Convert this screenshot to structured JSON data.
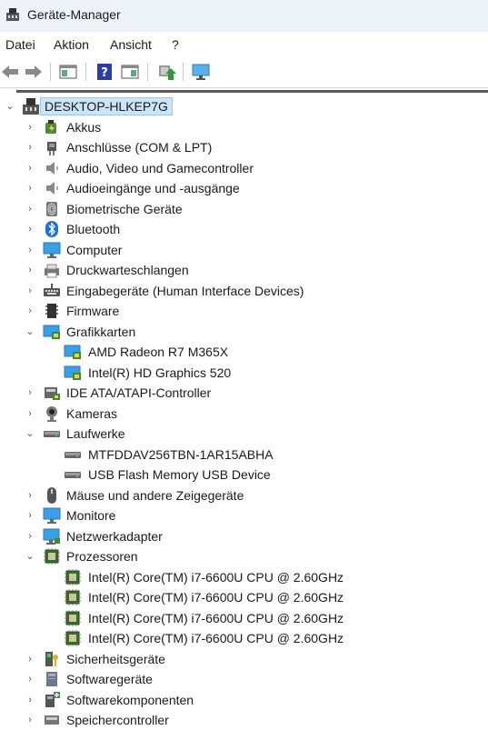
{
  "window": {
    "title": "Geräte-Manager"
  },
  "menu": [
    "Datei",
    "Aktion",
    "Ansicht",
    "?"
  ],
  "toolbar": {
    "buttons": [
      "back-icon",
      "forward-icon",
      "properties-pane-icon",
      "help-icon",
      "action-pane-icon",
      "update-driver-icon",
      "scan-hardware-icon"
    ]
  },
  "tree": {
    "root": "DESKTOP-HLKEP7G",
    "categories": [
      {
        "label": "Akkus",
        "icon": "battery-icon",
        "expanded": false
      },
      {
        "label": "Anschlüsse (COM & LPT)",
        "icon": "port-icon",
        "expanded": false
      },
      {
        "label": "Audio, Video und Gamecontroller",
        "icon": "speaker-icon",
        "expanded": false
      },
      {
        "label": "Audioeingänge und -ausgänge",
        "icon": "speaker-icon",
        "expanded": false
      },
      {
        "label": "Biometrische Geräte",
        "icon": "fingerprint-icon",
        "expanded": false
      },
      {
        "label": "Bluetooth",
        "icon": "bluetooth-icon",
        "expanded": false
      },
      {
        "label": "Computer",
        "icon": "monitor-icon",
        "expanded": false
      },
      {
        "label": "Druckwarteschlangen",
        "icon": "printer-icon",
        "expanded": false
      },
      {
        "label": "Eingabegeräte (Human Interface Devices)",
        "icon": "hid-icon",
        "expanded": false
      },
      {
        "label": "Firmware",
        "icon": "firmware-icon",
        "expanded": false
      },
      {
        "label": "Grafikkarten",
        "icon": "display-adapter-icon",
        "expanded": true,
        "children": [
          "AMD Radeon R7 M365X",
          "Intel(R) HD Graphics 520"
        ]
      },
      {
        "label": "IDE ATA/ATAPI-Controller",
        "icon": "ide-controller-icon",
        "expanded": false
      },
      {
        "label": "Kameras",
        "icon": "camera-icon",
        "expanded": false
      },
      {
        "label": "Laufwerke",
        "icon": "drive-icon",
        "expanded": true,
        "children": [
          "MTFDDAV256TBN-1AR15ABHA",
          "USB Flash Memory USB Device"
        ]
      },
      {
        "label": "Mäuse und andere Zeigegeräte",
        "icon": "mouse-icon",
        "expanded": false
      },
      {
        "label": "Monitore",
        "icon": "monitor-icon",
        "expanded": false
      },
      {
        "label": "Netzwerkadapter",
        "icon": "network-icon",
        "expanded": false
      },
      {
        "label": "Prozessoren",
        "icon": "cpu-icon",
        "expanded": true,
        "children": [
          "Intel(R) Core(TM) i7-6600U CPU @ 2.60GHz",
          "Intel(R) Core(TM) i7-6600U CPU @ 2.60GHz",
          "Intel(R) Core(TM) i7-6600U CPU @ 2.60GHz",
          "Intel(R) Core(TM) i7-6600U CPU @ 2.60GHz"
        ]
      },
      {
        "label": "Sicherheitsgeräte",
        "icon": "security-icon",
        "expanded": false
      },
      {
        "label": "Softwaregeräte",
        "icon": "software-device-icon",
        "expanded": false
      },
      {
        "label": "Softwarekomponenten",
        "icon": "software-component-icon",
        "expanded": false
      },
      {
        "label": "Speichercontroller",
        "icon": "storage-controller-icon",
        "expanded": false
      }
    ]
  }
}
